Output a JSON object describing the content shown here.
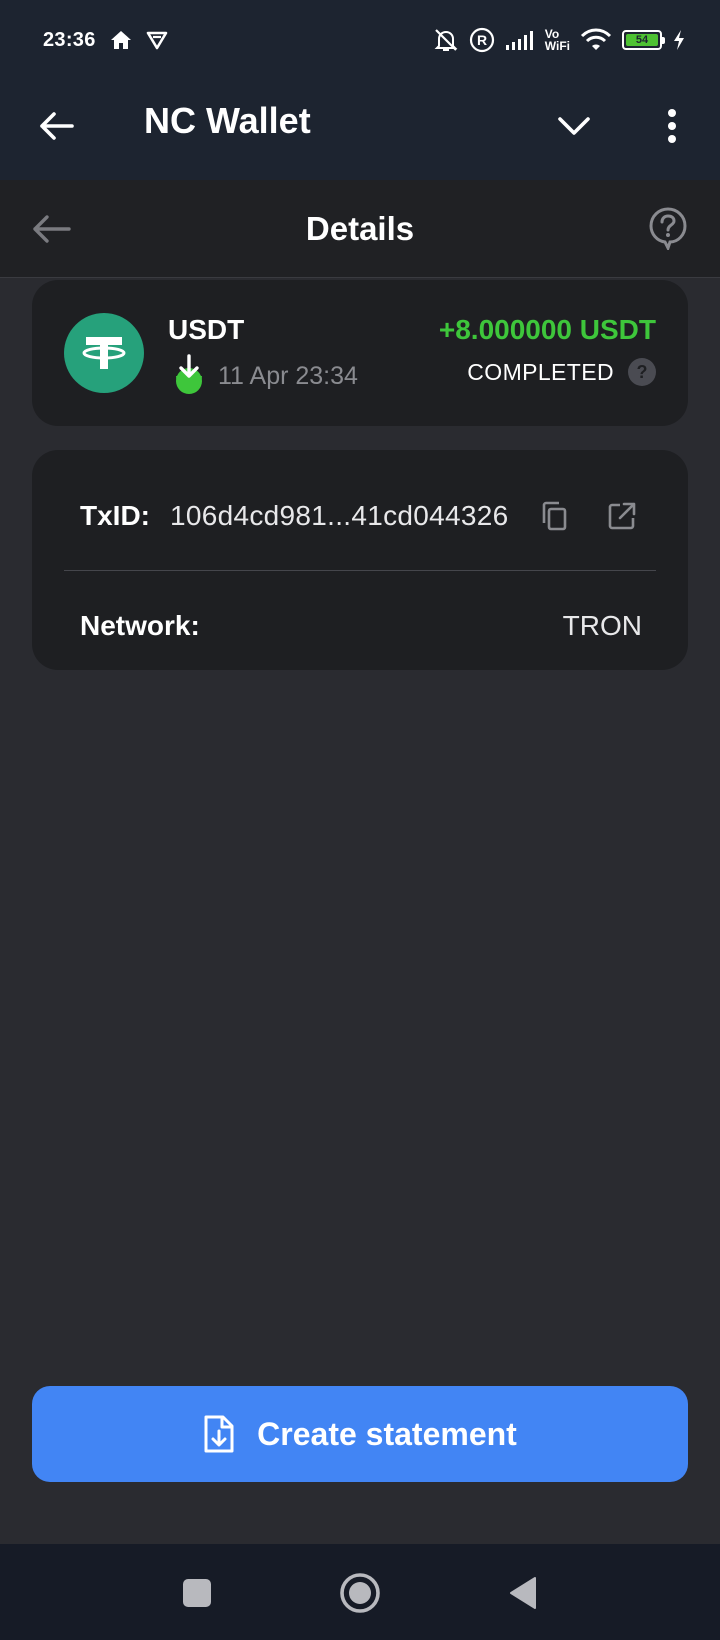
{
  "status_bar": {
    "time": "23:36",
    "network_label": "Vo\nWiFi",
    "battery_level": "54",
    "battery_color": "#4ec232",
    "icons": [
      "home-icon",
      "vpn-icon",
      "mute-bell-icon",
      "registered-icon",
      "signal-icon",
      "wifi-icon",
      "battery-icon",
      "charging-icon"
    ]
  },
  "app_bar": {
    "title": "NC Wallet",
    "icons": [
      "back-arrow-icon",
      "chevron-down-icon",
      "more-vertical-icon"
    ]
  },
  "details_header": {
    "title": "Details",
    "icons": [
      "back-arrow-icon",
      "help-icon"
    ]
  },
  "transaction": {
    "coin": "USDT",
    "coin_color": "#26a17b",
    "direction_icon": "incoming-arrow-icon",
    "date": "11 Apr 23:34",
    "amount": "+8.000000 USDT",
    "amount_color": "#3ec63b",
    "status": "COMPLETED",
    "status_help_glyph": "?"
  },
  "details": {
    "txid_label": "TxID:",
    "txid_value": "106d4cd981...41cd044326",
    "network_label": "Network:",
    "network_value": "TRON",
    "actions": [
      "copy-icon",
      "open-external-icon"
    ]
  },
  "footer": {
    "create_statement_label": "Create statement",
    "button_color": "#4285f4"
  },
  "nav_bar": {
    "icons": [
      "recents-square-icon",
      "home-circle-icon",
      "back-triangle-icon"
    ]
  }
}
